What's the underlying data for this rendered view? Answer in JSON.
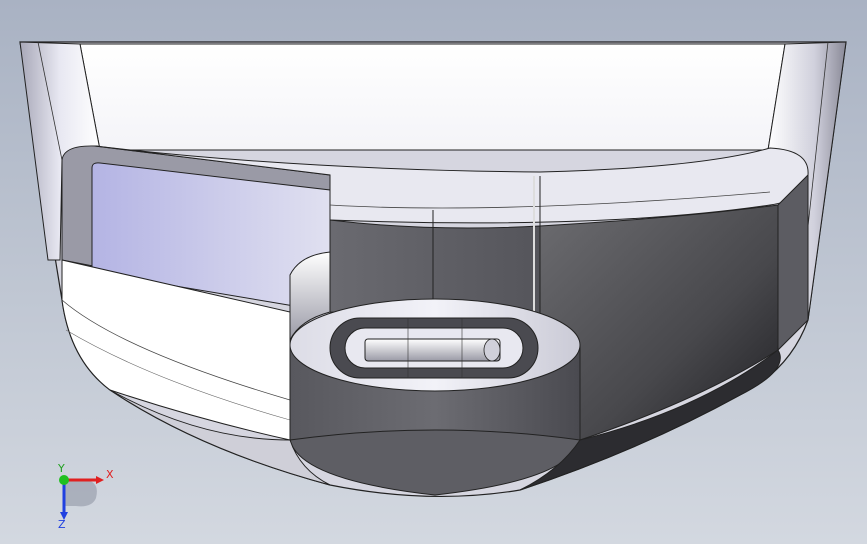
{
  "viewport": {
    "background_top": "#a9b2c3",
    "background_bottom": "#d3d8e0"
  },
  "model": {
    "light_face": "#ffffff",
    "mid_face": "#c9c9d3",
    "dark_face": "#5a5a60",
    "accent_face": "#b9b9e6"
  },
  "triad": {
    "x_label": "X",
    "y_label": "Y",
    "z_label": "Z",
    "x_color": "#e02020",
    "y_color": "#20c020",
    "z_color": "#2040e0"
  }
}
